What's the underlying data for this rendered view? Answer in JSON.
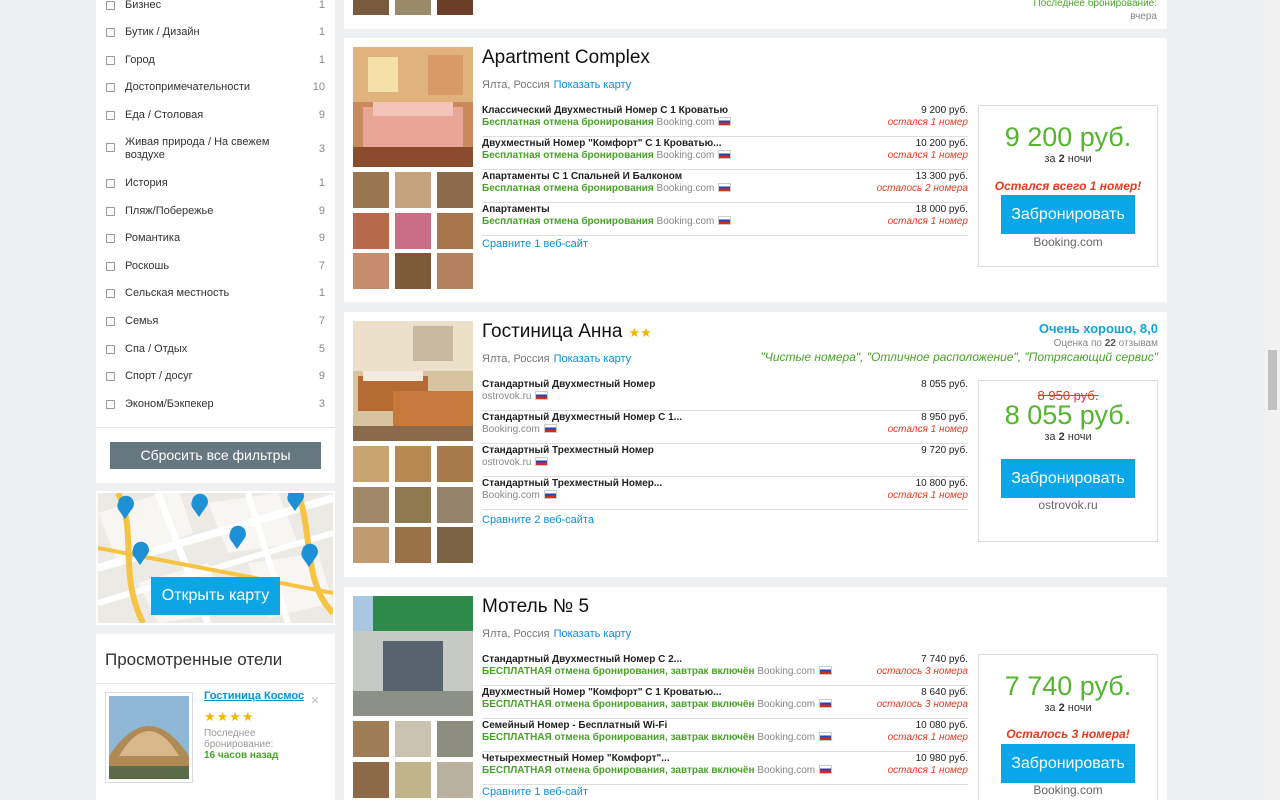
{
  "filters": [
    {
      "label": "Бизнес",
      "count": "1"
    },
    {
      "label": "Бутик / Дизайн",
      "count": "1"
    },
    {
      "label": "Город",
      "count": "1"
    },
    {
      "label": "Достопримечательности",
      "count": "10"
    },
    {
      "label": "Еда / Столовая",
      "count": "9"
    },
    {
      "label": "Живая природа / На свежем воздухе",
      "count": "3"
    },
    {
      "label": "История",
      "count": "1"
    },
    {
      "label": "Пляж/Побережье",
      "count": "9"
    },
    {
      "label": "Романтика",
      "count": "9"
    },
    {
      "label": "Роскошь",
      "count": "7"
    },
    {
      "label": "Сельская местность",
      "count": "1"
    },
    {
      "label": "Семья",
      "count": "7"
    },
    {
      "label": "Спа / Отдых",
      "count": "5"
    },
    {
      "label": "Спорт / досуг",
      "count": "9"
    },
    {
      "label": "Эконом/Бэкпекер",
      "count": "3"
    }
  ],
  "reset_label": "Сбросить все фильтры",
  "map_button": "Открыть карту",
  "viewed": {
    "title": "Просмотренные отели",
    "hotel_name": "Гостиница Космос",
    "stars": "★★★★",
    "last_booking_label": "Последнее бронирование:",
    "last_booking_time": "16 часов назад",
    "close": "×"
  },
  "top_strip": {
    "note": "Последнее бронирование:",
    "when": "вчера"
  },
  "hotels": [
    {
      "name": "Apartment Complex",
      "stars": "",
      "location": "Ялта, Россия",
      "show_map": "Показать карту",
      "rooms": [
        {
          "name": "Классический Двухместный Номер С 1 Кроватью",
          "cancel": "Бесплатная отмена бронирования",
          "provider": "Booking.com",
          "price": "9 200 руб.",
          "left": "остался 1 номер"
        },
        {
          "name": "Двухместный Номер \"Комфорт\" С 1 Кроватью...",
          "cancel": "Бесплатная отмена бронирования",
          "provider": "Booking.com",
          "price": "10 200 руб.",
          "left": "остался 1 номер"
        },
        {
          "name": "Апартаменты С 1 Спальней И Балконом",
          "cancel": "Бесплатная отмена бронирования",
          "provider": "Booking.com",
          "price": "13 300 руб.",
          "left": "осталось 2 номера"
        },
        {
          "name": "Апартаменты",
          "cancel": "Бесплатная отмена бронирования",
          "provider": "Booking.com",
          "price": "18 000 руб.",
          "left": "остался 1 номер"
        }
      ],
      "compare": "Сравните 1 веб-сайт",
      "price": "9 200 руб.",
      "old_price": "",
      "nights_prefix": "за",
      "nights_num": "2",
      "nights_suffix": "ночи",
      "note": "Остался всего 1 номер!",
      "book": "Забронировать",
      "provider": "Booking.com"
    },
    {
      "name": "Гостиница Анна",
      "stars": "★★",
      "location": "Ялта, Россия",
      "show_map": "Показать карту",
      "rating": "Очень хорошо, 8,0",
      "rating_prefix": "Оценка по",
      "rating_count": "22",
      "rating_suffix": "отзывам",
      "quotes": "\"Чистые номера\", \"Отличное расположение\", \"Потрясающий сервис\"",
      "rooms": [
        {
          "name": "Стандартный Двухместный Номер",
          "cancel": "",
          "provider": "ostrovok.ru",
          "price": "8 055 руб.",
          "left": ""
        },
        {
          "name": "Стандартный Двухместный Номер С 1...",
          "cancel": "",
          "provider": "Booking.com",
          "price": "8 950 руб.",
          "left": "остался 1 номер"
        },
        {
          "name": "Стандартный Трехместный Номер",
          "cancel": "",
          "provider": "ostrovok.ru",
          "price": "9 720 руб.",
          "left": ""
        },
        {
          "name": "Стандартный Трехместный Номер...",
          "cancel": "",
          "provider": "Booking.com",
          "price": "10 800 руб.",
          "left": "остался 1 номер"
        }
      ],
      "compare": "Сравните 2 веб-сайта",
      "price": "8 055 руб.",
      "old_price": "8 950 руб.",
      "nights_prefix": "за",
      "nights_num": "2",
      "nights_suffix": "ночи",
      "note": "",
      "book": "Забронировать",
      "provider": "ostrovok.ru"
    },
    {
      "name": "Мотель № 5",
      "stars": "",
      "location": "Ялта, Россия",
      "show_map": "Показать карту",
      "rooms": [
        {
          "name": "Стандартный Двухместный Номер С 2...",
          "cancel": "БЕСПЛАТНАЯ отмена бронирования, завтрак включён",
          "provider": "Booking.com",
          "price": "7 740 руб.",
          "left": "осталось 3 номера"
        },
        {
          "name": "Двухместный Номер \"Комфорт\" С 1 Кроватью...",
          "cancel": "БЕСПЛАТНАЯ отмена бронирования, завтрак включён",
          "provider": "Booking.com",
          "price": "8 640 руб.",
          "left": "осталось 3 номера"
        },
        {
          "name": "Семейный Номер - Бесплатный Wi-Fi",
          "cancel": "БЕСПЛАТНАЯ отмена бронирования, завтрак включён",
          "provider": "Booking.com",
          "price": "10 080 руб.",
          "left": "остался 1 номер"
        },
        {
          "name": "Четырехместный Номер \"Комфорт\"...",
          "cancel": "БЕСПЛАТНАЯ отмена бронирования, завтрак включён",
          "provider": "Booking.com",
          "price": "10 980 руб.",
          "left": "остался 1 номер"
        }
      ],
      "compare": "Сравните 1 веб-сайт",
      "price": "7 740 руб.",
      "old_price": "",
      "nights_prefix": "за",
      "nights_num": "2",
      "nights_suffix": "ночи",
      "note": "Осталось 3 номера!",
      "book": "Забронировать",
      "provider": "Booking.com"
    }
  ]
}
